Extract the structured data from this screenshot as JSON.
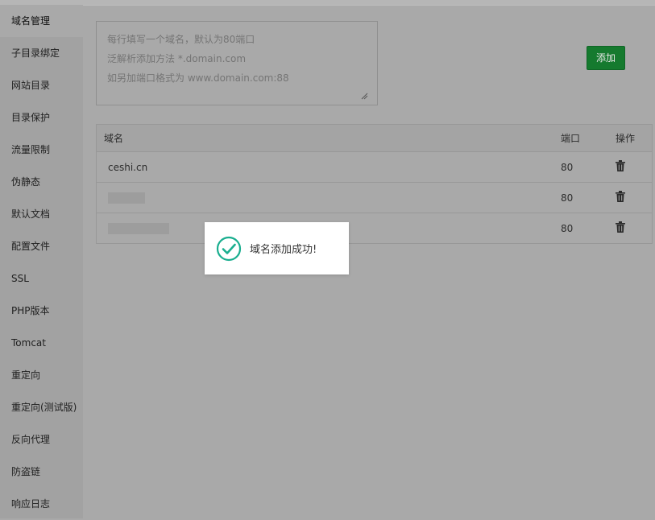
{
  "sidebar": {
    "items": [
      {
        "label": "域名管理"
      },
      {
        "label": "子目录绑定"
      },
      {
        "label": "网站目录"
      },
      {
        "label": "目录保护"
      },
      {
        "label": "流量限制"
      },
      {
        "label": "伪静态"
      },
      {
        "label": "默认文档"
      },
      {
        "label": "配置文件"
      },
      {
        "label": "SSL"
      },
      {
        "label": "PHP版本"
      },
      {
        "label": "Tomcat"
      },
      {
        "label": "重定向"
      },
      {
        "label": "重定向(测试版)"
      },
      {
        "label": "反向代理"
      },
      {
        "label": "防盗链"
      },
      {
        "label": "响应日志"
      }
    ]
  },
  "form": {
    "placeholder": "每行填写一个域名，默认为80端口\n泛解析添加方法 *.domain.com\n如另加端口格式为 www.domain.com:88",
    "add_label": "添加"
  },
  "table": {
    "headers": {
      "domain": "域名",
      "port": "端口",
      "op": "操作"
    },
    "rows": [
      {
        "domain": "ceshi.cn",
        "port": "80"
      },
      {
        "domain": "",
        "port": "80"
      },
      {
        "domain": "",
        "port": "80"
      }
    ]
  },
  "toast": {
    "message": "域名添加成功!"
  },
  "colors": {
    "accent": "#20a53a",
    "success_icon": "#1aae8f"
  }
}
